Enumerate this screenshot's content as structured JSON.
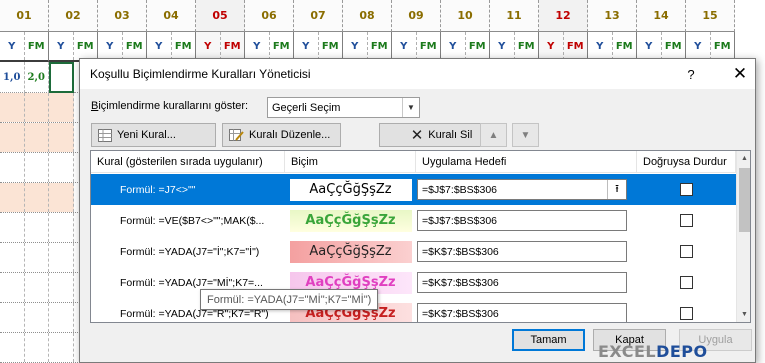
{
  "sheet": {
    "columns": [
      {
        "label": "01",
        "red": false
      },
      {
        "label": "02",
        "red": false
      },
      {
        "label": "03",
        "red": false
      },
      {
        "label": "04",
        "red": false
      },
      {
        "label": "05",
        "red": true
      },
      {
        "label": "06",
        "red": false
      },
      {
        "label": "07",
        "red": false
      },
      {
        "label": "08",
        "red": false
      },
      {
        "label": "09",
        "red": false
      },
      {
        "label": "10",
        "red": false
      },
      {
        "label": "11",
        "red": false
      },
      {
        "label": "12",
        "red": true
      },
      {
        "label": "13",
        "red": false
      },
      {
        "label": "14",
        "red": false
      },
      {
        "label": "15",
        "red": false
      }
    ],
    "sub_y": "Y",
    "sub_fm": "FM",
    "first_row_values": [
      "1,0",
      "2,0"
    ]
  },
  "dialog": {
    "title": "Koşullu Biçimlendirme Kuralları Yöneticisi",
    "help": "?",
    "close": "✕",
    "show_label_underlined": "B",
    "show_label_rest": "içimlendirme kurallarını göster:",
    "show_value": "Geçerli Seçim",
    "new_rule": "Yeni Kural...",
    "edit_rule": "Kuralı Düzenle...",
    "delete_rule": "Kuralı Sil",
    "columns": {
      "rule": "Kural (gösterilen sırada uygulanır)",
      "format": "Biçim",
      "applies_to": "Uygulama Hedefi",
      "stop_if_true": "Doğruysa Durdur"
    },
    "rules": [
      {
        "formula": "Formül: =J7<>\"\"",
        "preview": "AaÇçĞğŞşZz",
        "applies_to": "=$J$7:$BS$306",
        "style": "p1",
        "selected": true
      },
      {
        "formula": "Formül: =VE($B7<>\"\";MAK($...",
        "preview": "AaÇçĞğŞşZz",
        "applies_to": "=$J$7:$BS$306",
        "style": "p2",
        "selected": false
      },
      {
        "formula": "Formül: =YADA(J7=\"İ\";K7=\"İ\")",
        "preview": "AaÇçĞğŞşZz",
        "applies_to": "=$K$7:$BS$306",
        "style": "p3",
        "selected": false
      },
      {
        "formula": "Formül: =YADA(J7=\"Mİ\";K7=...",
        "preview": "AaÇçĞğŞşZz",
        "applies_to": "=$K$7:$BS$306",
        "style": "p4",
        "selected": false
      },
      {
        "formula": "Formül: =YADA(J7=\"R\";K7=\"R\")",
        "preview": "AaÇçĞğŞşZz",
        "applies_to": "=$K$7:$BS$306",
        "style": "p5",
        "selected": false
      }
    ],
    "tooltip": "Formül: =YADA(J7=\"Mİ\";K7=\"Mİ\")",
    "ok": "Tamam",
    "close_button": "Kapat",
    "apply": "Uygula"
  },
  "watermark": {
    "part1": "EXCEL",
    "part2": "DEPO"
  },
  "colors": {
    "accent": "#0078d7",
    "header_gold": "#8a6d00",
    "red": "#c00000",
    "y_blue": "#1f4e9a",
    "fm_green": "#1b7a1b"
  }
}
